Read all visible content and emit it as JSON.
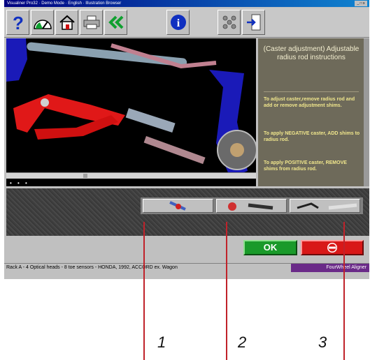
{
  "window": {
    "title": "Visualiner Pro32 · Demo Mode · English · Illustration Browser"
  },
  "toolbar": {
    "buttons": [
      {
        "icon": "help-icon"
      },
      {
        "icon": "gauge-icon"
      },
      {
        "icon": "home-icon"
      },
      {
        "icon": "printer-icon"
      },
      {
        "icon": "back-arrow-icon"
      },
      {
        "icon": "info-icon"
      },
      {
        "icon": "molecule-icon"
      },
      {
        "icon": "import-icon"
      }
    ]
  },
  "panel": {
    "title": "(Caster adjustment) Adjustable radius rod instructions",
    "instructions": [
      "To adjust caster,remove radius rod and add or remove adjustment shims.",
      "To apply NEGATIVE caster, ADD shims to radius rod.",
      "To apply POSITIVE caster, REMOVE shims from radius rod."
    ]
  },
  "actions": {
    "ok_label": "OK"
  },
  "status": {
    "text": "Rack A - 4 Optical heads - 8 toe sensors - HONDA, 1992, ACCORD ex. Wagon",
    "brand": "FourWheel Aligner"
  },
  "callouts": [
    "1",
    "2",
    "3"
  ],
  "colors": {
    "ok_green": "#1a9a2a",
    "cancel_red": "#d81818",
    "callout_red": "#c0222a",
    "instruction_yellow": "#f0e68c"
  }
}
